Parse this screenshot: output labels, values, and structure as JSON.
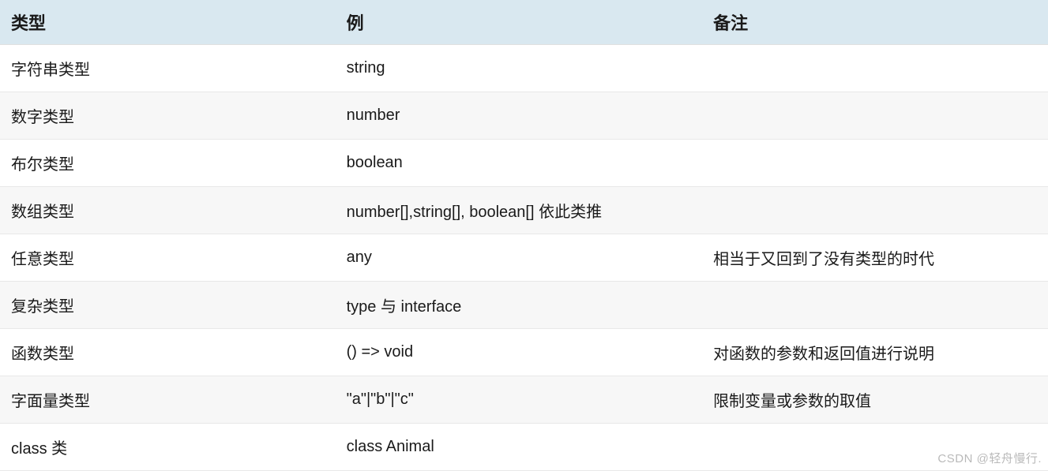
{
  "table": {
    "headers": {
      "type": "类型",
      "example": "例",
      "note": "备注"
    },
    "rows": [
      {
        "type": "字符串类型",
        "example": "string",
        "note": ""
      },
      {
        "type": "数字类型",
        "example": "number",
        "note": ""
      },
      {
        "type": "布尔类型",
        "example": "boolean",
        "note": ""
      },
      {
        "type": "数组类型",
        "example": "number[],string[], boolean[] 依此类推",
        "note": ""
      },
      {
        "type": "任意类型",
        "example": "any",
        "note": "相当于又回到了没有类型的时代"
      },
      {
        "type": "复杂类型",
        "example": "type 与 interface",
        "note": ""
      },
      {
        "type": "函数类型",
        "example": "() => void",
        "note": "对函数的参数和返回值进行说明"
      },
      {
        "type": "字面量类型",
        "example": "\"a\"|\"b\"|\"c\"",
        "note": "限制变量或参数的取值"
      },
      {
        "type": "class 类",
        "example": "class Animal",
        "note": ""
      }
    ]
  },
  "watermark": "CSDN @轻舟慢行."
}
